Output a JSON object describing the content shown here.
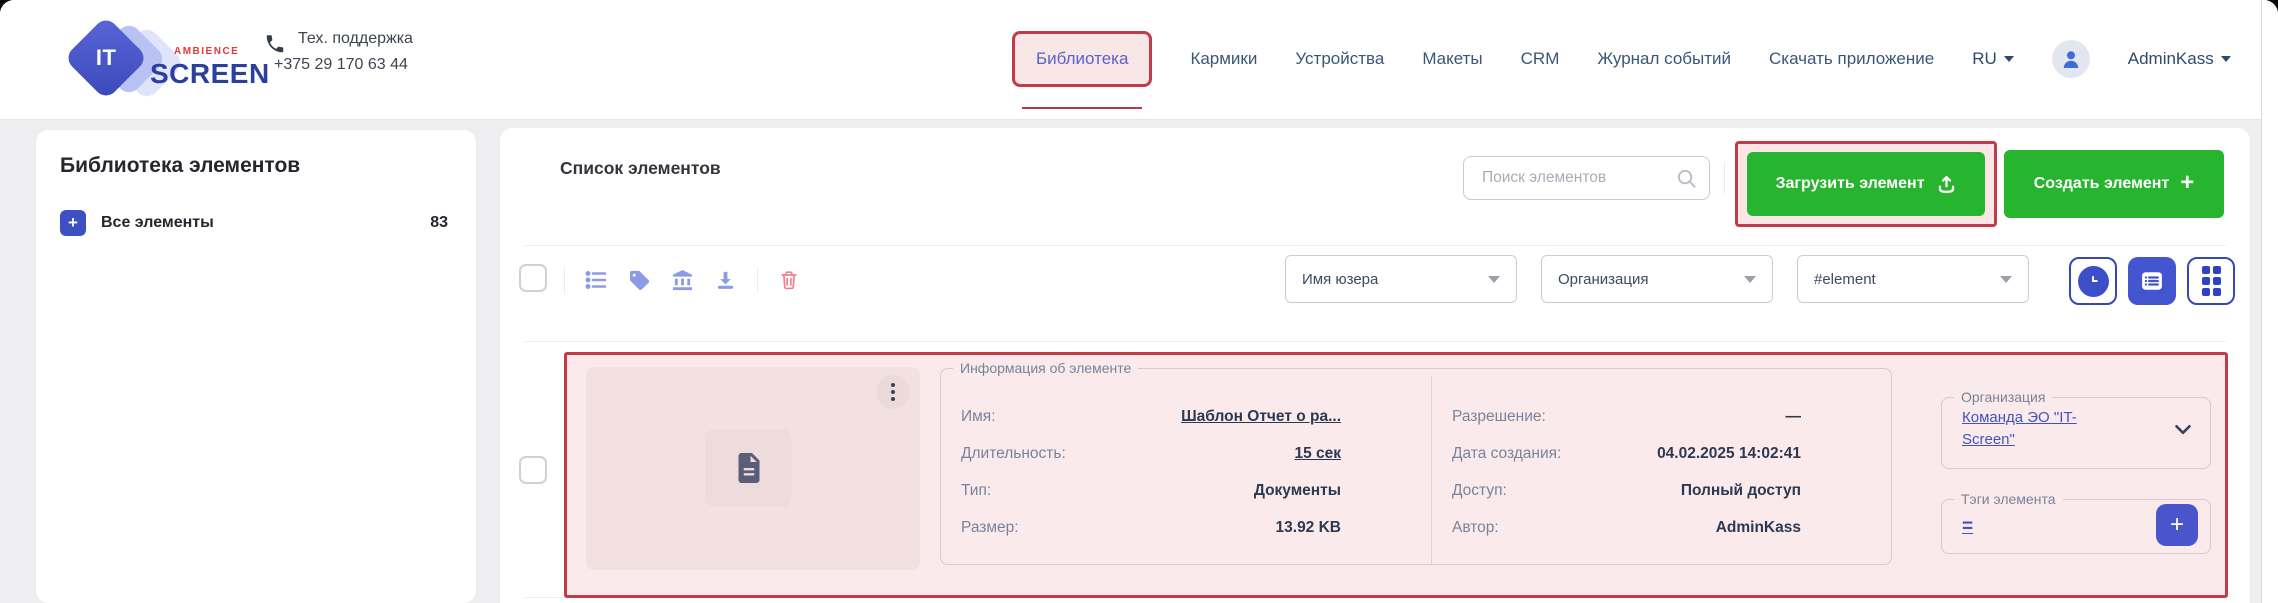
{
  "header": {
    "logo": {
      "it": "IT",
      "ambience": "AMBIENCE",
      "screen": "SCREEN"
    },
    "support": {
      "label": "Тех. поддержка",
      "phone": "+375 29 170 63 44"
    },
    "nav": {
      "items": [
        "Библиотека",
        "Кармики",
        "Устройства",
        "Макеты",
        "CRM",
        "Журнал событий",
        "Скачать приложение"
      ],
      "language": "RU",
      "user": "AdminKass"
    }
  },
  "sidebar": {
    "title": "Библиотека элементов",
    "items": [
      {
        "label": "Все элементы",
        "count": "83"
      }
    ]
  },
  "main": {
    "title": "Список элементов",
    "search": {
      "placeholder": "Поиск элементов"
    },
    "buttons": {
      "upload": "Загрузить элемент",
      "create": "Создать элемент",
      "create_plus": "+"
    },
    "filters": [
      {
        "value": "Имя юзера"
      },
      {
        "value": "Организация"
      },
      {
        "value": "#element"
      }
    ],
    "element": {
      "info_legend": "Информация об элементе",
      "details_left": [
        {
          "label": "Имя:",
          "value": "Шаблон Отчет о ра..."
        },
        {
          "label": "Длительность:",
          "value": "15 сек"
        },
        {
          "label": "Тип:",
          "value": "Документы"
        },
        {
          "label": "Размер:",
          "value": "13.92 KB"
        }
      ],
      "details_right": [
        {
          "label": "Разрешение:",
          "value": "—"
        },
        {
          "label": "Дата создания:",
          "value": "04.02.2025 14:02:41"
        },
        {
          "label": "Доступ:",
          "value": "Полный доступ"
        },
        {
          "label": "Автор:",
          "value": "AdminKass"
        }
      ],
      "organization": {
        "legend": "Организация",
        "value": "Команда ЭО \"IT-Screen\""
      },
      "tags": {
        "legend": "Тэги элемента",
        "value": "="
      }
    }
  },
  "colors": {
    "accent_green": "#27b42f",
    "accent_blue": "#4355cf",
    "annotation_red": "#c23b49",
    "link_blue": "#4053c2",
    "nav_text": "#3a5678",
    "active_tab_text": "#5a61c8"
  }
}
